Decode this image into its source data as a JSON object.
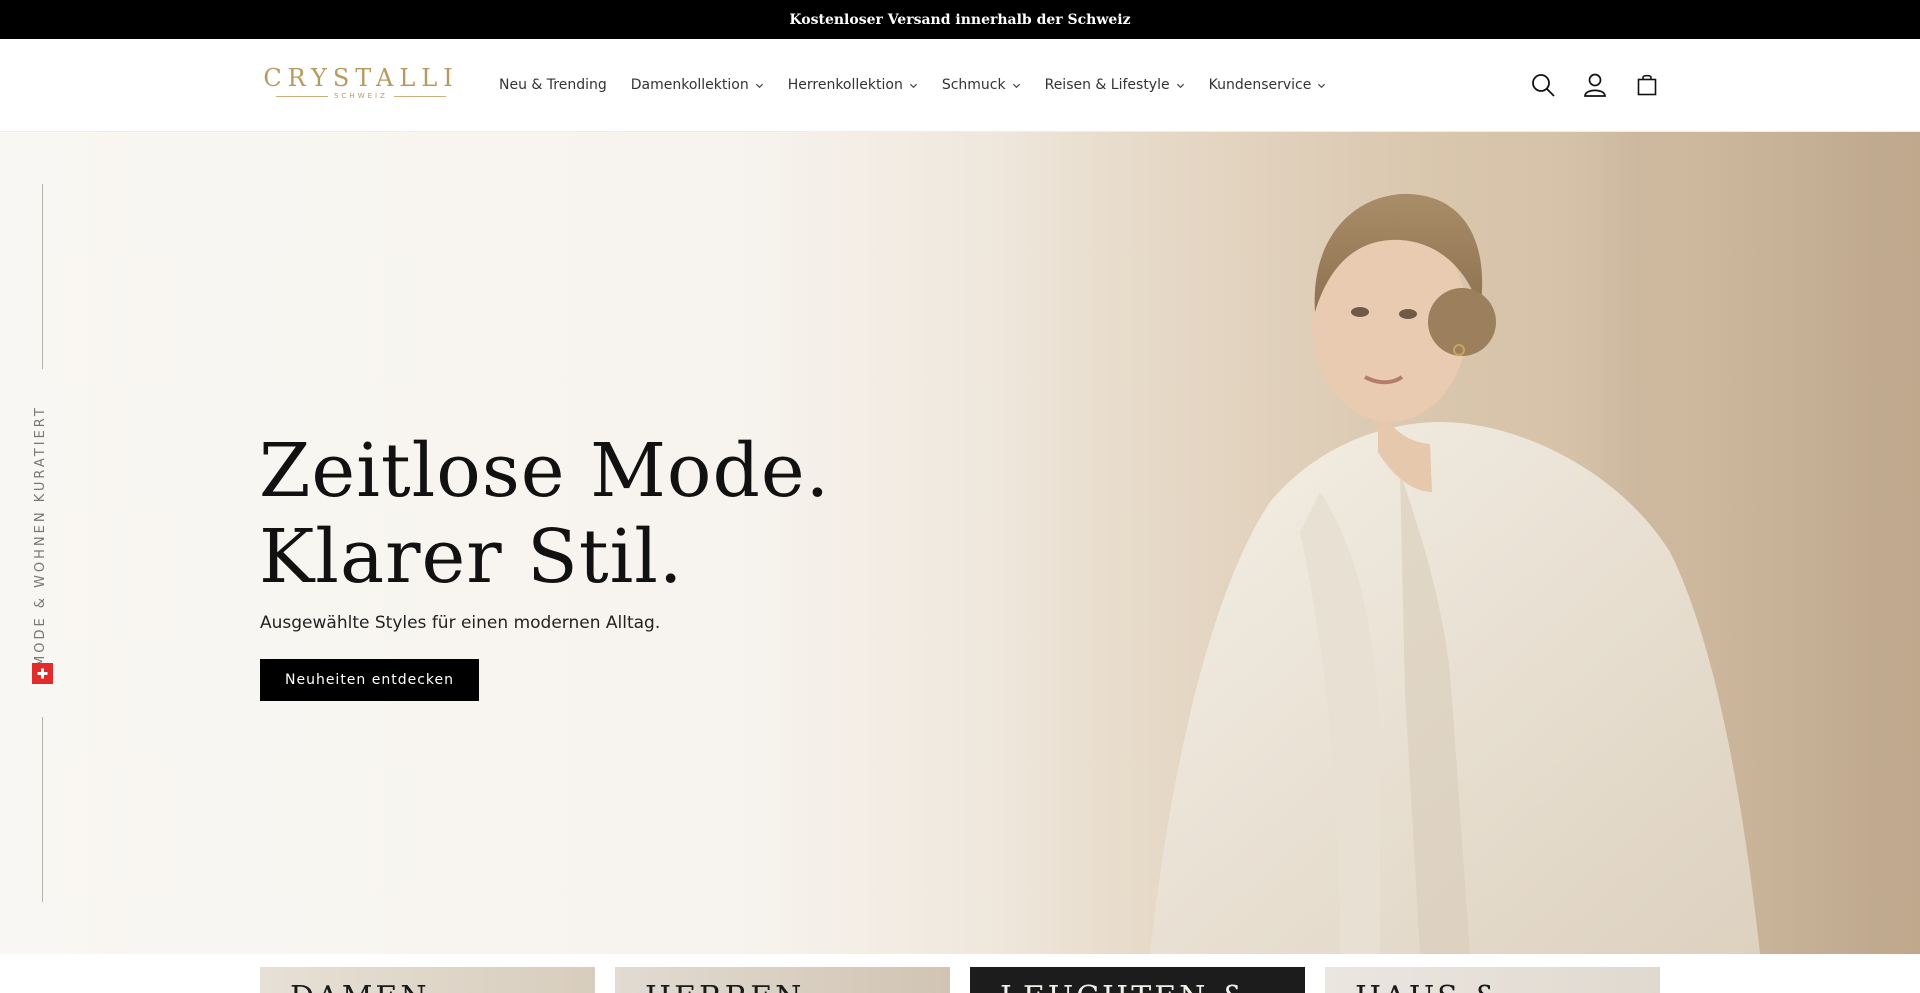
{
  "announcement": {
    "text": "Kostenloser Versand innerhalb der Schweiz"
  },
  "brand": {
    "name": "CRYSTALLI",
    "sub": "SCHWEIZ",
    "color": "#b89a5e"
  },
  "nav": {
    "items": [
      {
        "label": "Neu & Trending",
        "has_dropdown": false
      },
      {
        "label": "Damenkollektion",
        "has_dropdown": true
      },
      {
        "label": "Herrenkollektion",
        "has_dropdown": true
      },
      {
        "label": "Schmuck",
        "has_dropdown": true
      },
      {
        "label": "Reisen & Lifestyle",
        "has_dropdown": true
      },
      {
        "label": "Kundenservice",
        "has_dropdown": true
      }
    ]
  },
  "header_icons": [
    "search-icon",
    "account-icon",
    "cart-icon"
  ],
  "hero": {
    "side_text": "MODE & WOHNEN KURATIERT",
    "title_line1": "Zeitlose Mode.",
    "title_line2": "Klarer Stil.",
    "subtitle": "Ausgewählte Styles für einen modernen Alltag.",
    "cta": "Neuheiten entdecken"
  },
  "cards": [
    {
      "label": "DAMEN"
    },
    {
      "label": "HERREN"
    },
    {
      "label": "LEUCHTEN &"
    },
    {
      "label": "HAUS &"
    }
  ]
}
